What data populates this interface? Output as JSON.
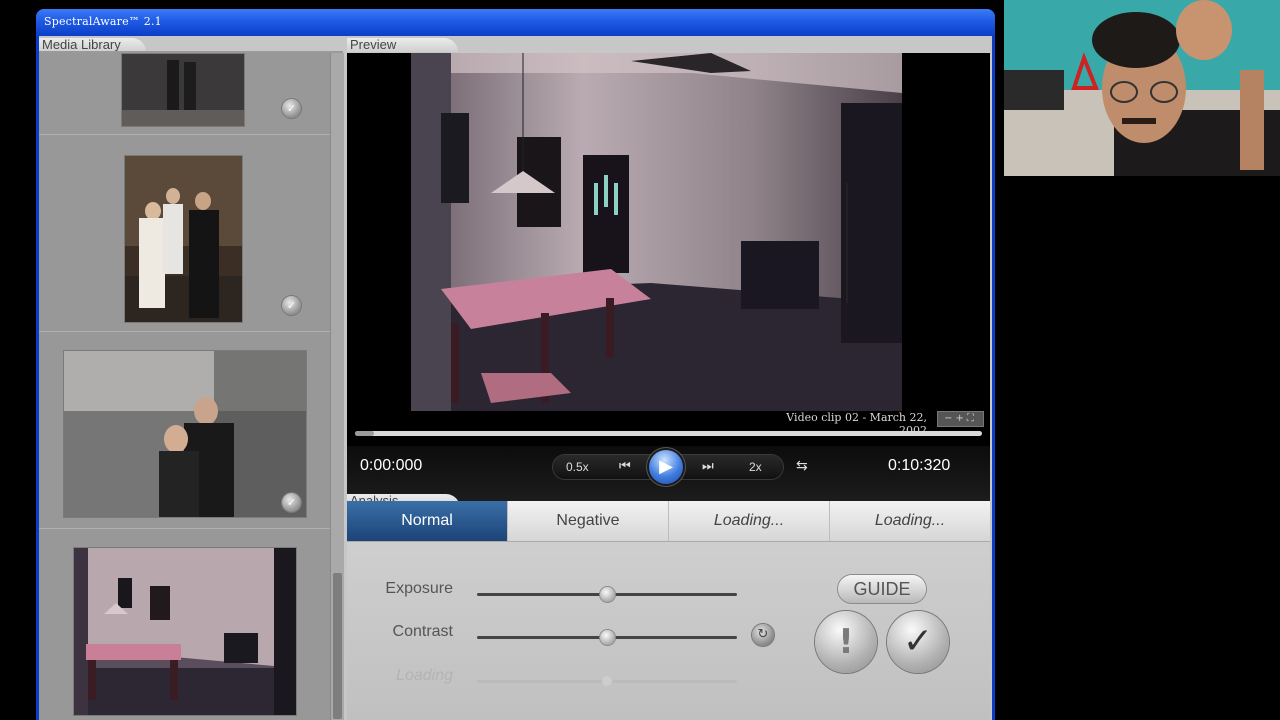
{
  "window": {
    "title": "SpectralAware™ 2.1"
  },
  "media_library": {
    "label": "Media Library",
    "items": [
      {
        "name": "thumbnail-1",
        "checked": true
      },
      {
        "name": "thumbnail-2",
        "checked": true
      },
      {
        "name": "thumbnail-3",
        "checked": true
      },
      {
        "name": "thumbnail-4",
        "checked": false
      }
    ]
  },
  "preview": {
    "label": "Preview",
    "clip_label": "Video clip 02 - March 22, 2002",
    "zoom_controls": "−+⛶",
    "progress": 0.03,
    "current_time": "0:00:000",
    "total_time": "0:10:320",
    "slow_speed": "0.5x",
    "fast_speed": "2x"
  },
  "analysis": {
    "label": "Analysis",
    "modes": [
      "Normal",
      "Negative",
      "Loading...",
      "Loading..."
    ],
    "sliders": [
      {
        "label": "Exposure",
        "value": 0.5,
        "enabled": true
      },
      {
        "label": "Contrast",
        "value": 0.5,
        "enabled": true
      },
      {
        "label": "Loading",
        "value": 0.5,
        "enabled": false
      }
    ],
    "guide_label": "GUIDE",
    "alert_glyph": "!",
    "confirm_glyph": "✓"
  },
  "colors": {
    "window_blue": "#0b3ec6",
    "active_tab": "#2a5a90",
    "play_blue": "#3f7ce0"
  }
}
